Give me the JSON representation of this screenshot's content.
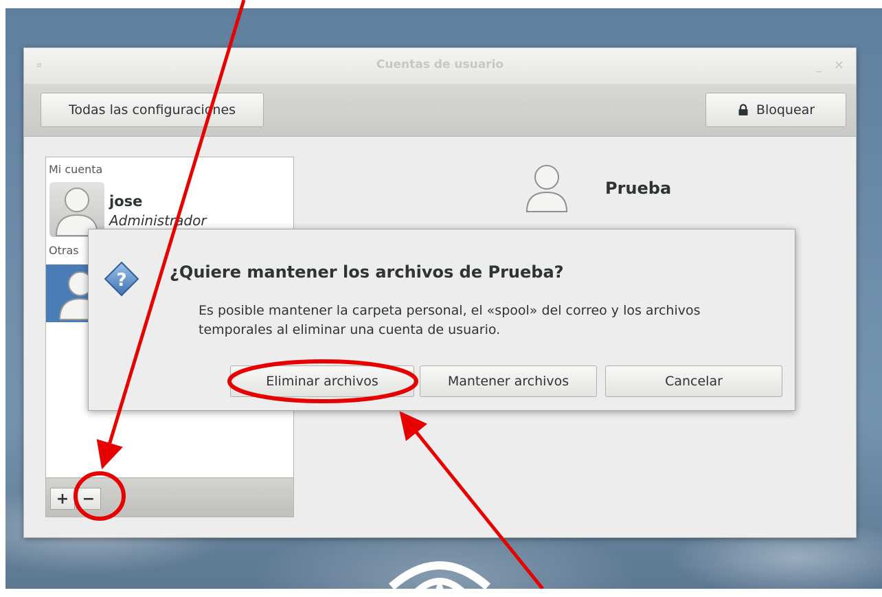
{
  "window": {
    "title": "Cuentas de usuario",
    "menu_glyph": "¤",
    "minimize_glyph": "_",
    "close_glyph": "×"
  },
  "toolbar": {
    "all_settings_label": "Todas las configuraciones",
    "lock_label": "Bloquear"
  },
  "accounts": {
    "my_account_label": "Mi cuenta",
    "others_label": "Otras",
    "my_account": {
      "name": "jose",
      "role": "Administrador"
    },
    "add_label": "+",
    "remove_label": "−"
  },
  "user_header": {
    "name": "Prueba"
  },
  "dialog": {
    "title": "¿Quiere mantener los archivos de Prueba?",
    "message": "Es posible mantener la carpeta personal, el «spool» del correo y los archivos temporales al eliminar una cuenta de usuario.",
    "buttons": {
      "delete": "Eliminar archivos",
      "keep": "Mantener archivos",
      "cancel": "Cancelar"
    }
  },
  "annotation_color": "#e60000",
  "selection_color": "#4a7cb6"
}
